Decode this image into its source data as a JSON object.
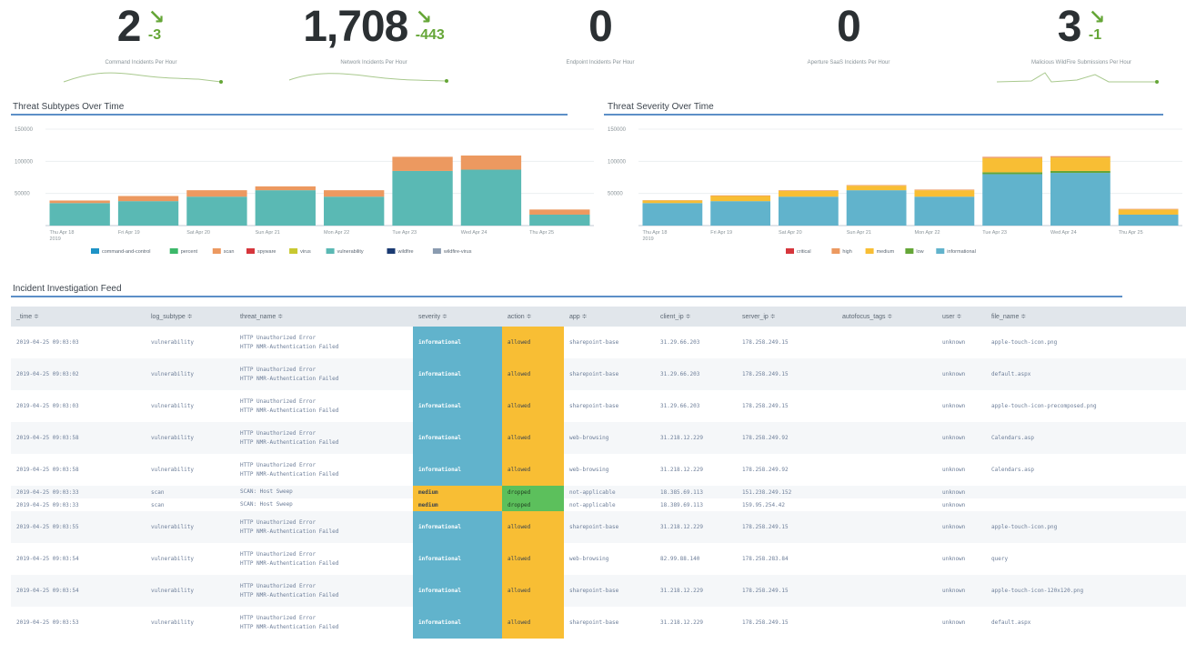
{
  "kpis": [
    {
      "value": "2",
      "arrow": "↘",
      "change": "-3",
      "label": "Command Incidents Per Hour"
    },
    {
      "value": "1,708",
      "arrow": "↘",
      "change": "-443",
      "label": "Network Incidents Per Hour"
    },
    {
      "value": "0",
      "arrow": "",
      "change": "",
      "label": "Endpoint Incidents Per Hour"
    },
    {
      "value": "0",
      "arrow": "",
      "change": "",
      "label": "Aperture SaaS Incidents Per Hour"
    },
    {
      "value": "3",
      "arrow": "↘",
      "change": "-1",
      "label": "Malicious WildFire Submissions Per Hour"
    }
  ],
  "panels": {
    "subtypes_title": "Threat Subtypes Over Time",
    "severity_title": "Threat Severity Over Time",
    "feed_title": "Incident Investigation Feed"
  },
  "colors": {
    "accent_rule": "#5c8fc7",
    "spark": "#65a637",
    "teal": "#5ab9b4",
    "orange": "#ec9960",
    "sky": "#61b3cc",
    "yellow": "#f8be34",
    "green": "#65a637"
  },
  "chart_data": [
    {
      "type": "bar",
      "title": "Threat Subtypes Over Time",
      "categories": [
        "Thu Apr 18 2019",
        "Fri Apr 19",
        "Sat Apr 20",
        "Sun Apr 21",
        "Mon Apr 22",
        "Tue Apr 23",
        "Wed Apr 24",
        "Thu Apr 25"
      ],
      "ytick_labels": [
        "150000",
        "100000",
        "50000"
      ],
      "ylim": [
        0,
        150000
      ],
      "stacked": true,
      "series": [
        {
          "name": "command-and-control",
          "color": "#1e93c6",
          "values": [
            0,
            0,
            0,
            0,
            0,
            0,
            0,
            0
          ]
        },
        {
          "name": "percent",
          "color": "#3cb86a",
          "values": [
            0,
            0,
            0,
            0,
            0,
            0,
            0,
            0
          ]
        },
        {
          "name": "scan",
          "color": "#ec9960",
          "values": [
            4000,
            8000,
            10000,
            6000,
            10000,
            22000,
            22000,
            8000
          ]
        },
        {
          "name": "spyware",
          "color": "#d6363c",
          "values": [
            0,
            0,
            0,
            0,
            0,
            0,
            0,
            0
          ]
        },
        {
          "name": "virus",
          "color": "#c8c830",
          "values": [
            0,
            0,
            0,
            0,
            0,
            0,
            0,
            0
          ]
        },
        {
          "name": "vulnerability",
          "color": "#5ab9b4",
          "values": [
            35000,
            38000,
            45000,
            55000,
            45000,
            85000,
            87000,
            17000
          ]
        },
        {
          "name": "wildfire",
          "color": "#1a3a72",
          "values": [
            0,
            0,
            0,
            0,
            0,
            0,
            0,
            0
          ]
        },
        {
          "name": "wildfire-virus",
          "color": "#8a9bb0",
          "values": [
            0,
            0,
            0,
            0,
            0,
            0,
            0,
            0
          ]
        }
      ],
      "legend": "bottom"
    },
    {
      "type": "bar",
      "title": "Threat Severity Over Time",
      "categories": [
        "Thu Apr 18 2019",
        "Fri Apr 19",
        "Sat Apr 20",
        "Sun Apr 21",
        "Mon Apr 22",
        "Tue Apr 23",
        "Wed Apr 24",
        "Thu Apr 25"
      ],
      "ytick_labels": [
        "150000",
        "100000",
        "50000"
      ],
      "ylim": [
        0,
        150000
      ],
      "stacked": true,
      "series": [
        {
          "name": "critical",
          "color": "#d6363c",
          "values": [
            0,
            0,
            0,
            0,
            0,
            0,
            0,
            0
          ]
        },
        {
          "name": "high",
          "color": "#ec9960",
          "values": [
            500,
            1000,
            1000,
            1000,
            1000,
            2000,
            2000,
            1000
          ]
        },
        {
          "name": "medium",
          "color": "#f8be34",
          "values": [
            4000,
            8000,
            9000,
            7000,
            10000,
            22000,
            21000,
            8000
          ]
        },
        {
          "name": "low",
          "color": "#65a637",
          "values": [
            0,
            0,
            0,
            0,
            0,
            3000,
            3000,
            0
          ]
        },
        {
          "name": "informational",
          "color": "#61b3cc",
          "values": [
            35000,
            38000,
            45000,
            55000,
            45000,
            80000,
            82000,
            17000
          ]
        }
      ],
      "legend": "bottom"
    }
  ],
  "table": {
    "columns": [
      "_time ≑",
      "log_subtype ≑",
      "threat_name ≑",
      "severity ≑",
      "action ≑",
      "app ≑",
      "client_ip ≑",
      "server_ip ≑",
      "autofocus_tags ≑",
      "user ≑",
      "file_name ≑"
    ],
    "rows": [
      {
        "time": "2019-04-25 09:03:03",
        "subtype": "vulnerability",
        "threat1": "HTTP Unauthorized Error",
        "threat2": "HTTP NMR-Authentication Failed",
        "severity": "informational",
        "action": "allowed",
        "app": "sharepoint-base",
        "client": "31.29.66.203",
        "server": "178.258.249.15",
        "tags": "",
        "user": "unknown",
        "file": "apple-touch-icon.png",
        "kind": "tall"
      },
      {
        "time": "2019-04-25 09:03:02",
        "subtype": "vulnerability",
        "threat1": "HTTP Unauthorized Error",
        "threat2": "HTTP NMR-Authentication Failed",
        "severity": "informational",
        "action": "allowed",
        "app": "sharepoint-base",
        "client": "31.29.66.203",
        "server": "178.258.249.15",
        "tags": "",
        "user": "unknown",
        "file": "default.aspx",
        "kind": "tall"
      },
      {
        "time": "2019-04-25 09:03:03",
        "subtype": "vulnerability",
        "threat1": "HTTP Unauthorized Error",
        "threat2": "HTTP NMR-Authentication Failed",
        "severity": "informational",
        "action": "allowed",
        "app": "sharepoint-base",
        "client": "31.29.66.203",
        "server": "178.258.249.15",
        "tags": "",
        "user": "unknown",
        "file": "apple-touch-icon-precomposed.png",
        "kind": "tall"
      },
      {
        "time": "2019-04-25 09:03:58",
        "subtype": "vulnerability",
        "threat1": "HTTP Unauthorized Error",
        "threat2": "HTTP NMR-Authentication Failed",
        "severity": "informational",
        "action": "allowed",
        "app": "web-browsing",
        "client": "31.218.12.229",
        "server": "178.258.249.92",
        "tags": "",
        "user": "unknown",
        "file": "Calendars.asp",
        "kind": "tall"
      },
      {
        "time": "2019-04-25 09:03:58",
        "subtype": "vulnerability",
        "threat1": "HTTP Unauthorized Error",
        "threat2": "HTTP NMR-Authentication Failed",
        "severity": "informational",
        "action": "allowed",
        "app": "web-browsing",
        "client": "31.218.12.229",
        "server": "178.258.249.92",
        "tags": "",
        "user": "unknown",
        "file": "Calendars.asp",
        "kind": "tall"
      },
      {
        "time": "2019-04-25 09:03:33",
        "subtype": "scan",
        "threat1": "SCAN: Host Sweep",
        "threat2": "",
        "severity": "medium",
        "action": "dropped",
        "app": "not-applicable",
        "client": "18.385.69.113",
        "server": "151.238.249.152",
        "tags": "",
        "user": "unknown",
        "file": "",
        "kind": "short"
      },
      {
        "time": "2019-04-25 09:03:33",
        "subtype": "scan",
        "threat1": "SCAN: Host Sweep",
        "threat2": "",
        "severity": "medium",
        "action": "dropped",
        "app": "not-applicable",
        "client": "18.389.69.113",
        "server": "159.95.254.42",
        "tags": "",
        "user": "unknown",
        "file": "",
        "kind": "short"
      },
      {
        "time": "2019-04-25 09:03:55",
        "subtype": "vulnerability",
        "threat1": "HTTP Unauthorized Error",
        "threat2": "HTTP NMR-Authentication Failed",
        "severity": "informational",
        "action": "allowed",
        "app": "sharepoint-base",
        "client": "31.218.12.229",
        "server": "178.258.249.15",
        "tags": "",
        "user": "unknown",
        "file": "apple-touch-icon.png",
        "kind": "tall"
      },
      {
        "time": "2019-04-25 09:03:54",
        "subtype": "vulnerability",
        "threat1": "HTTP Unauthorized Error",
        "threat2": "HTTP NMR-Authentication Failed",
        "severity": "informational",
        "action": "allowed",
        "app": "web-browsing",
        "client": "82.99.88.140",
        "server": "178.258.283.84",
        "tags": "",
        "user": "unknown",
        "file": "query",
        "kind": "tall"
      },
      {
        "time": "2019-04-25 09:03:54",
        "subtype": "vulnerability",
        "threat1": "HTTP Unauthorized Error",
        "threat2": "HTTP NMR-Authentication Failed",
        "severity": "informational",
        "action": "allowed",
        "app": "sharepoint-base",
        "client": "31.218.12.229",
        "server": "178.258.249.15",
        "tags": "",
        "user": "unknown",
        "file": "apple-touch-icon-120x120.png",
        "kind": "tall"
      },
      {
        "time": "2019-04-25 09:03:53",
        "subtype": "vulnerability",
        "threat1": "HTTP Unauthorized Error",
        "threat2": "HTTP NMR-Authentication Failed",
        "severity": "informational",
        "action": "allowed",
        "app": "sharepoint-base",
        "client": "31.218.12.229",
        "server": "178.258.249.15",
        "tags": "",
        "user": "unknown",
        "file": "default.aspx",
        "kind": "tall"
      }
    ]
  }
}
